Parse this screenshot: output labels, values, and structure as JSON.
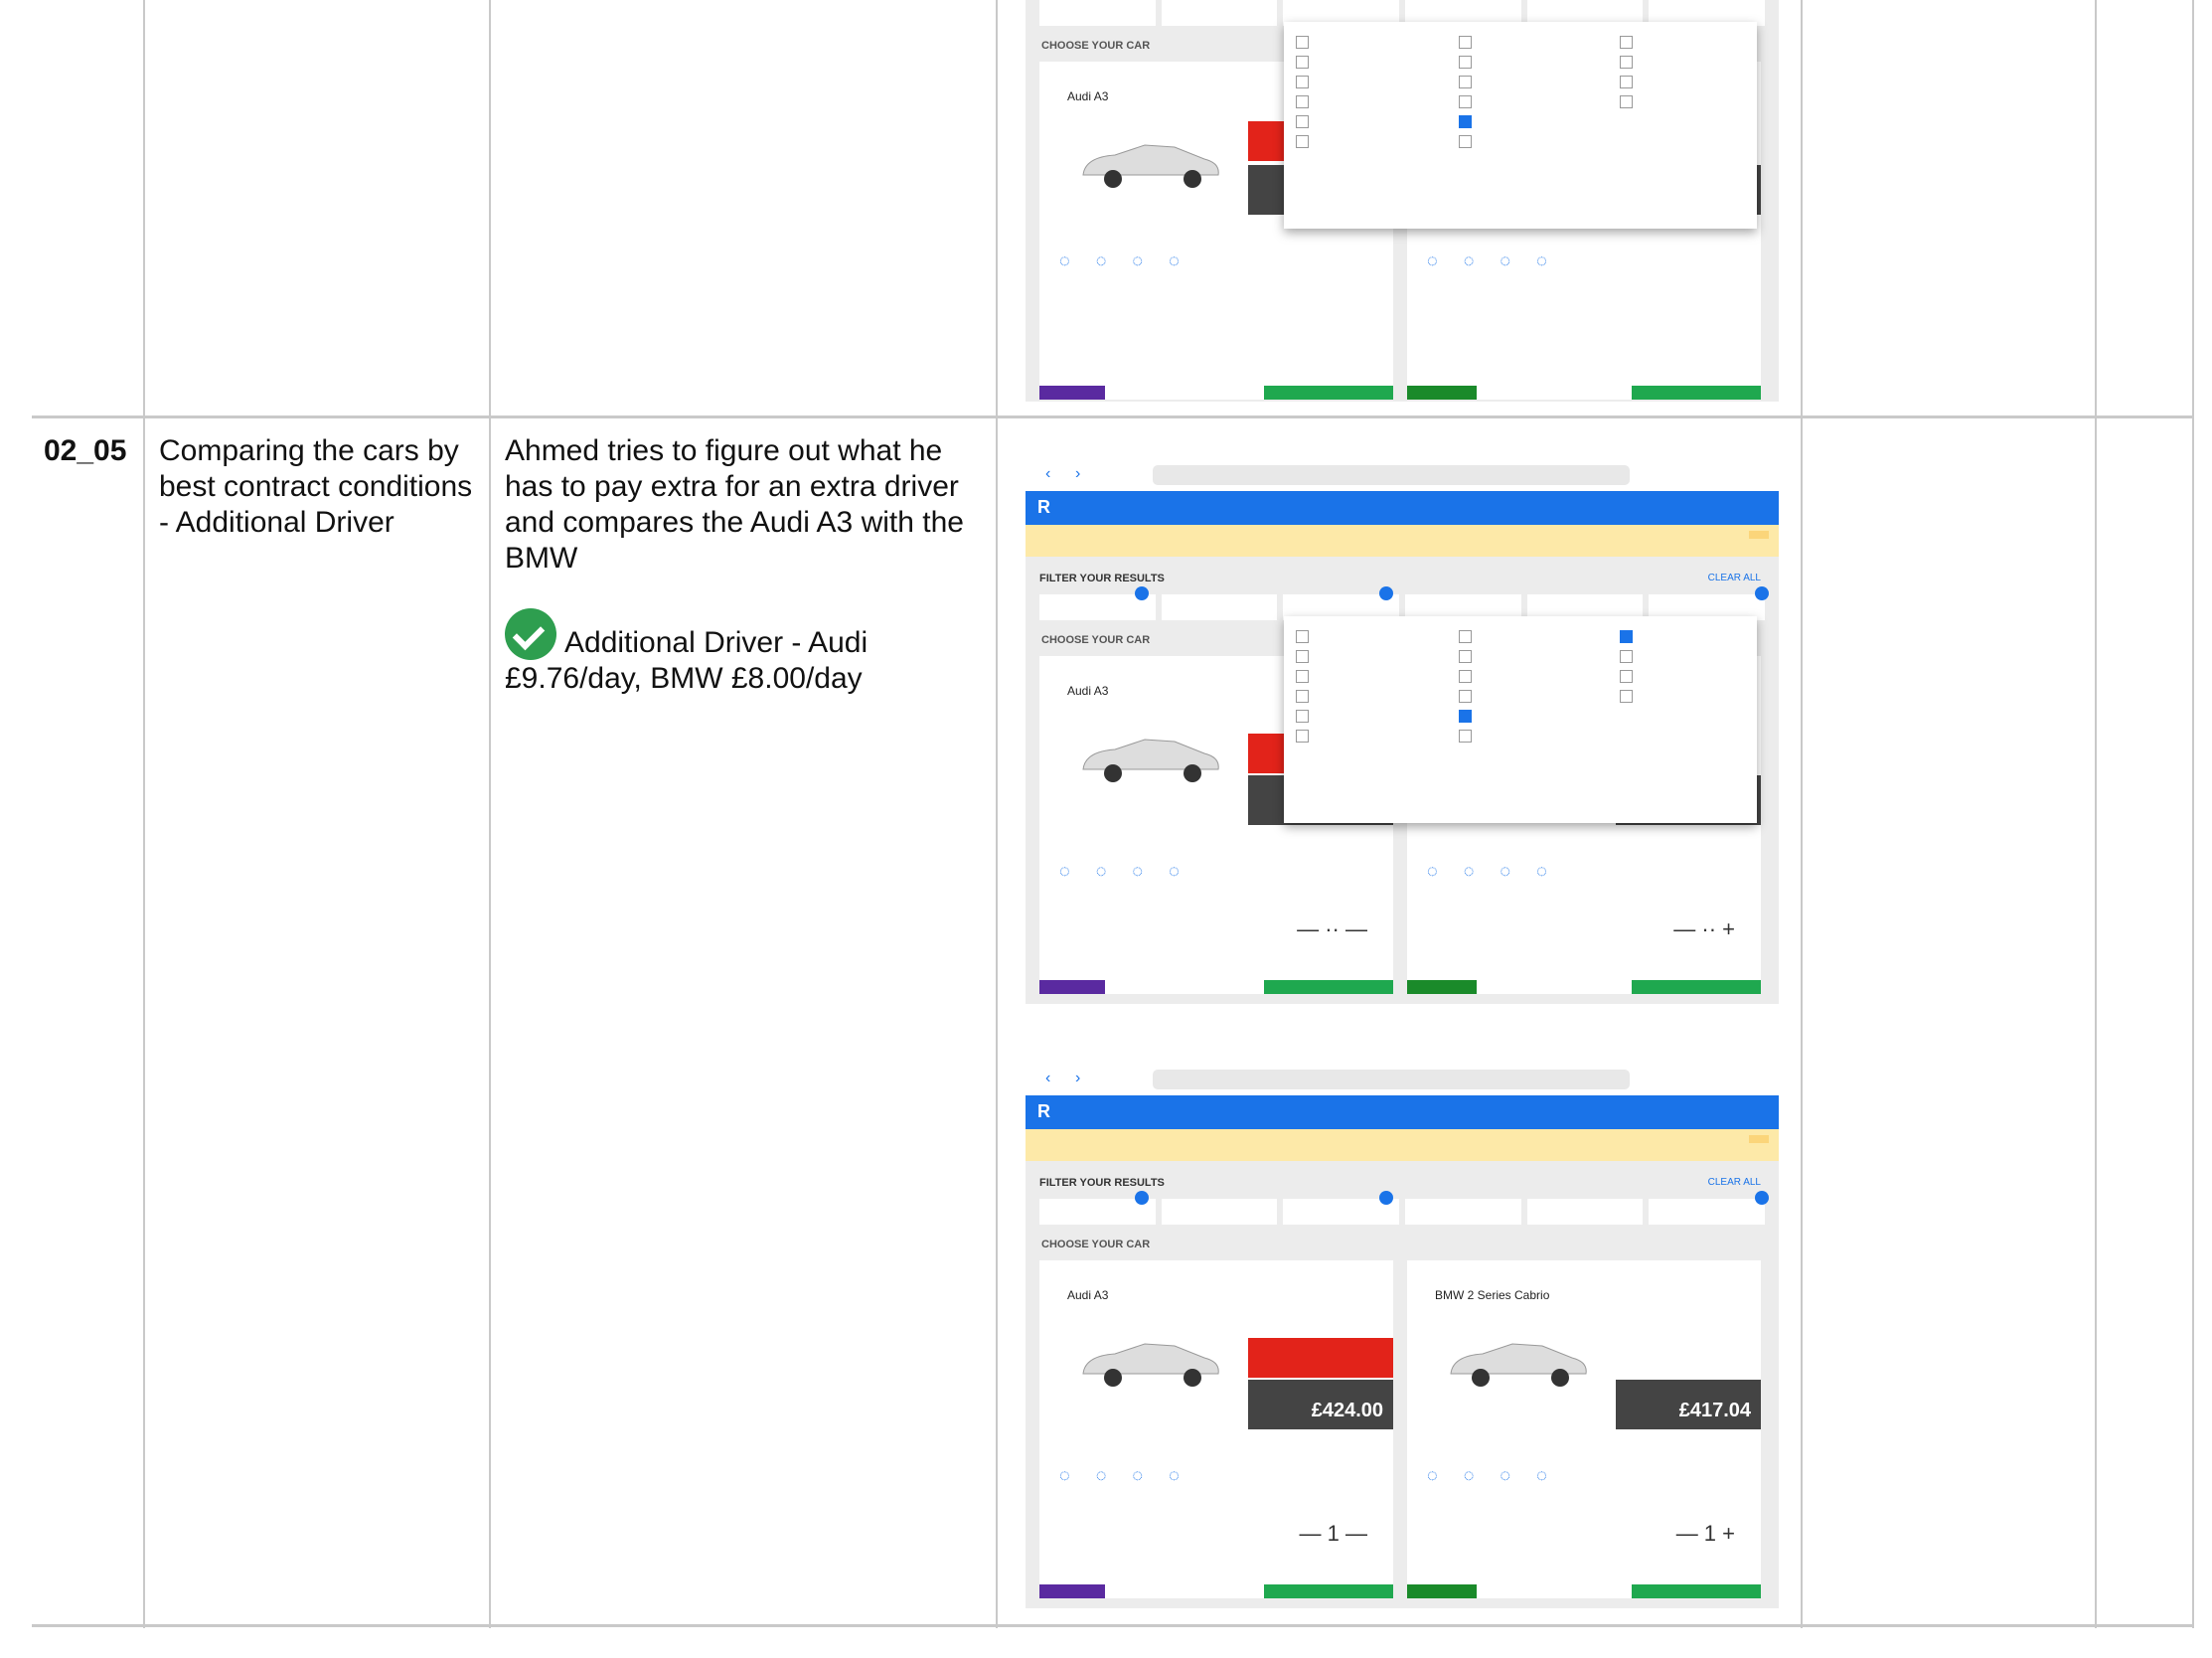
{
  "rows": [
    {
      "id": "",
      "step": "",
      "description": "",
      "result": "",
      "screens": 1
    },
    {
      "id": "02_05",
      "step": "Comparing the cars by best contract conditions - Additional Driver",
      "description": "Ahmed tries to figure out what he has to pay extra for an extra driver and compares the Audi A3 with the BMW",
      "result": "Additional Driver - Audi £9.76/day, BMW £8.00/day"
    }
  ],
  "mock": {
    "filter_title": "FILTER YOUR RESULTS",
    "clear_all": "CLEAR ALL",
    "choose_car": "CHOOSE YOUR CAR",
    "card1": {
      "name": "Audi A3",
      "price": "£424.00"
    },
    "card2": {
      "name": "BMW 2 Series Cabrio",
      "price": "£417.04"
    }
  }
}
